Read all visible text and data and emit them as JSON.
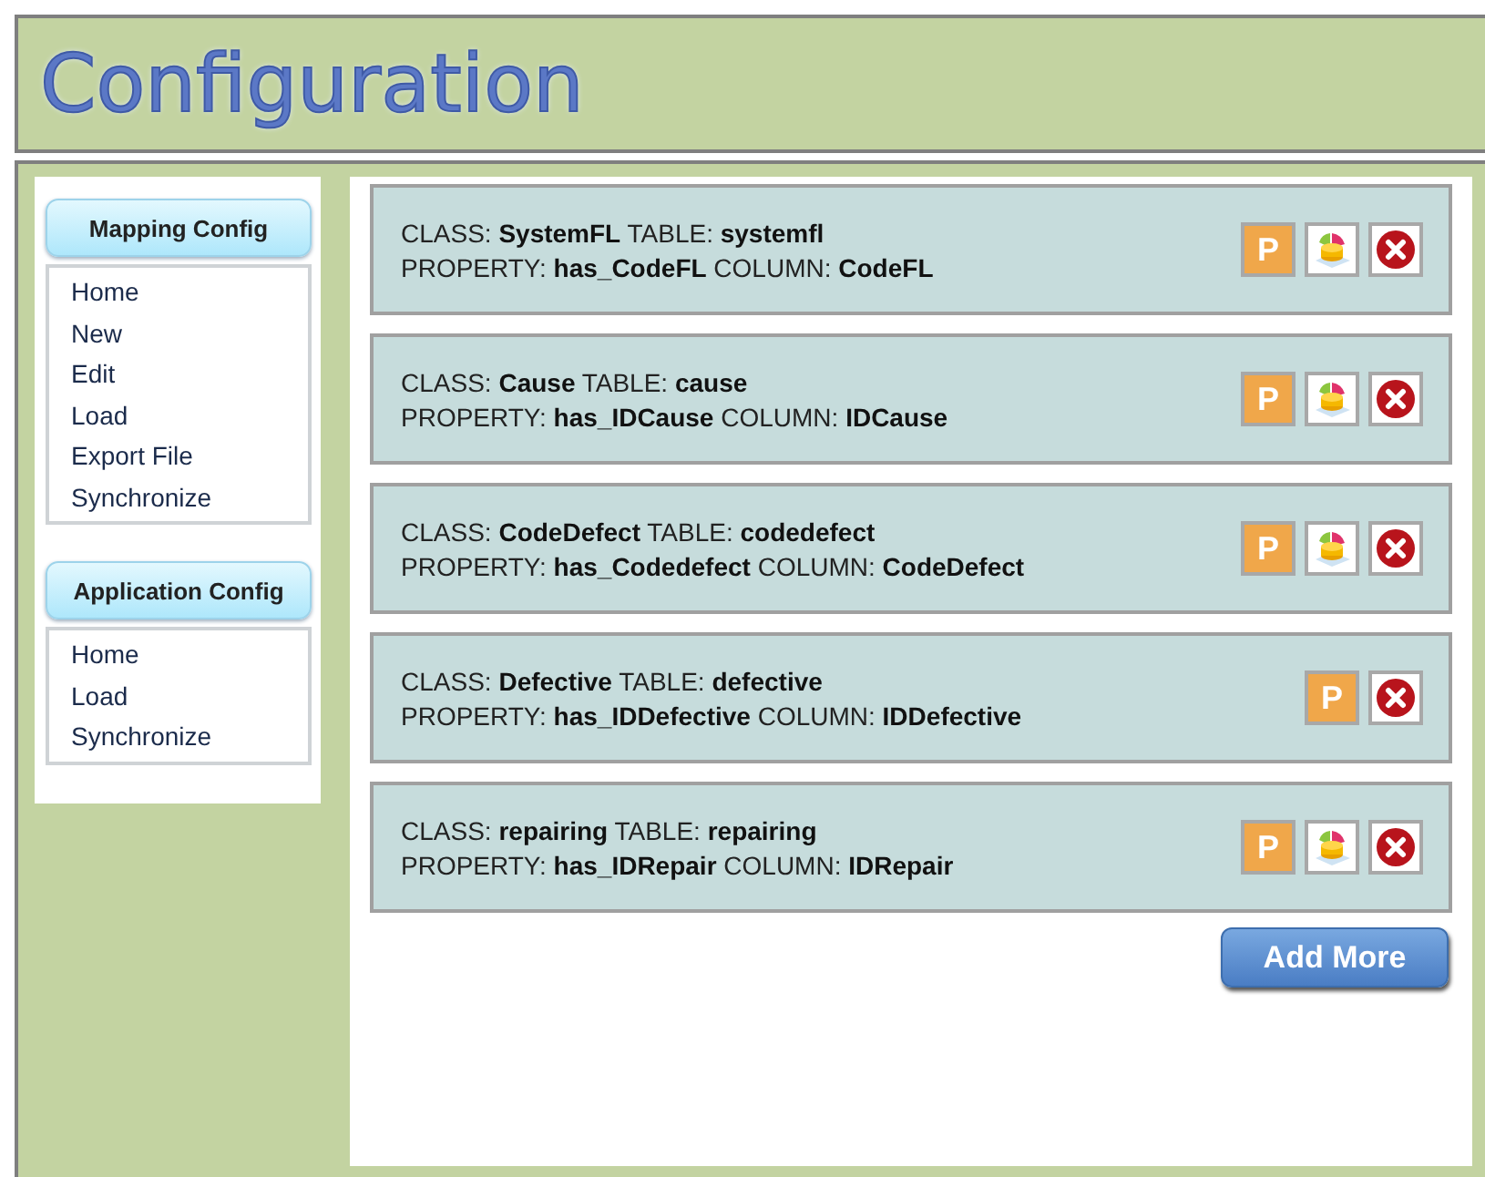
{
  "header": {
    "title": "Configuration"
  },
  "sidebar": {
    "sections": [
      {
        "title": "Mapping Config",
        "items": [
          "Home",
          "New",
          "Edit",
          "Load",
          "Export File",
          "Synchronize"
        ]
      },
      {
        "title": "Application Config",
        "items": [
          "Home",
          "Load",
          "Synchronize"
        ]
      }
    ]
  },
  "mappings": [
    {
      "class_line": "CLASS: **SystemFL** TABLE: **systemfl**",
      "property_line": "PROPERTY: **has_CodeFL** COLUMN: **CodeFL**",
      "actions": [
        {
          "kind": "property",
          "label": "P"
        },
        {
          "kind": "chart"
        },
        {
          "kind": "delete"
        }
      ]
    },
    {
      "class_line": "CLASS: **Cause** TABLE: **cause**",
      "property_line": "PROPERTY: **has_IDCause** COLUMN: **IDCause**",
      "actions": [
        {
          "kind": "property",
          "label": "P"
        },
        {
          "kind": "chart"
        },
        {
          "kind": "delete"
        }
      ]
    },
    {
      "class_line": "CLASS: **CodeDefect** TABLE: **codedefect**",
      "property_line": "PROPERTY: **has_Codedefect** COLUMN: **CodeDefect**",
      "actions": [
        {
          "kind": "property",
          "label": "P"
        },
        {
          "kind": "chart"
        },
        {
          "kind": "delete"
        }
      ]
    },
    {
      "class_line": "CLASS: **Defective** TABLE: **defective**",
      "property_line": "PROPERTY: **has_IDDefective** COLUMN: **IDDefective**",
      "actions": [
        {
          "kind": "property",
          "label": "P"
        },
        {
          "kind": "delete"
        }
      ]
    },
    {
      "class_line": "CLASS: **repairing** TABLE: **repairing**",
      "property_line": "PROPERTY: **has_IDRepair** COLUMN: **IDRepair**",
      "actions": [
        {
          "kind": "property",
          "label": "P"
        },
        {
          "kind": "chart"
        },
        {
          "kind": "delete"
        }
      ]
    }
  ],
  "add_button": "Add More"
}
